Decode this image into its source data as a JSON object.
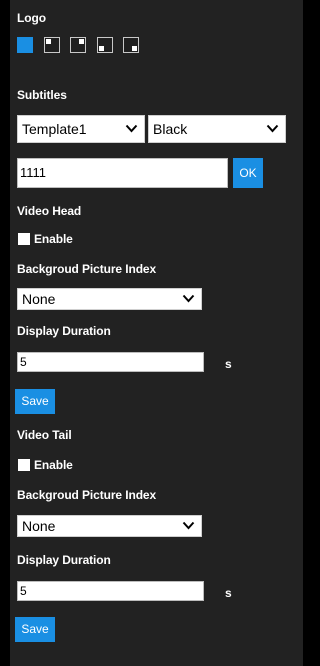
{
  "logo": {
    "label": "Logo",
    "options": [
      {
        "icon": "logo-solid-icon",
        "selected": true
      },
      {
        "icon": "logo-top-left-icon",
        "selected": false
      },
      {
        "icon": "logo-top-right-icon",
        "selected": false
      },
      {
        "icon": "logo-bottom-left-icon",
        "selected": false
      },
      {
        "icon": "logo-bottom-right-icon",
        "selected": false
      }
    ]
  },
  "subtitles": {
    "label": "Subtitles",
    "template_value": "Template1",
    "color_value": "Black",
    "text_value": "1111",
    "ok_label": "OK"
  },
  "video_head": {
    "label": "Video Head",
    "enable_label": "Enable",
    "enabled": false,
    "bg_index_label": "Backgroud Picture Index",
    "bg_index_value": "None",
    "duration_label": "Display Duration",
    "duration_value": "5",
    "unit": "s",
    "save_label": "Save"
  },
  "video_tail": {
    "label": "Video Tail",
    "enable_label": "Enable",
    "enabled": false,
    "bg_index_label": "Backgroud Picture Index",
    "bg_index_value": "None",
    "duration_label": "Display Duration",
    "duration_value": "5",
    "unit": "s",
    "save_label": "Save"
  },
  "colors": {
    "accent": "#1a8fe3",
    "panel_background": "#222222",
    "page_background": "#000000"
  }
}
